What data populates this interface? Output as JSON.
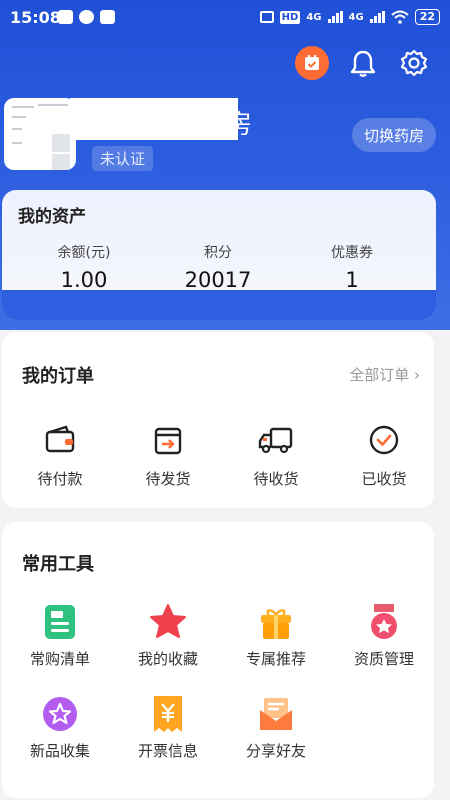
{
  "status_bar": {
    "time": "15:08",
    "battery": "22",
    "network": "4G"
  },
  "header": {
    "name_suffix": "房",
    "verify_status": "未认证",
    "switch_label": "切换药房"
  },
  "assets": {
    "title": "我的资产",
    "items": [
      {
        "label": "余额(元)",
        "value": "1.00"
      },
      {
        "label": "积分",
        "value": "20017"
      },
      {
        "label": "优惠券",
        "value": "1"
      }
    ]
  },
  "orders": {
    "title": "我的订单",
    "all_label": "全部订单",
    "items": [
      {
        "label": "待付款",
        "icon": "wallet-icon"
      },
      {
        "label": "待发货",
        "icon": "box-arrow-icon"
      },
      {
        "label": "待收货",
        "icon": "truck-icon"
      },
      {
        "label": "已收货",
        "icon": "check-circle-icon"
      }
    ]
  },
  "tools": {
    "title": "常用工具",
    "items": [
      {
        "label": "常购清单",
        "icon": "list-doc-icon"
      },
      {
        "label": "我的收藏",
        "icon": "star-icon"
      },
      {
        "label": "专属推荐",
        "icon": "gift-icon"
      },
      {
        "label": "资质管理",
        "icon": "medal-icon"
      },
      {
        "label": "新品收集",
        "icon": "new-star-icon"
      },
      {
        "label": "开票信息",
        "icon": "invoice-icon"
      },
      {
        "label": "分享好友",
        "icon": "share-mail-icon"
      }
    ]
  },
  "colors": {
    "brand": "#2f5fe0",
    "accent": "#ff6b35"
  }
}
